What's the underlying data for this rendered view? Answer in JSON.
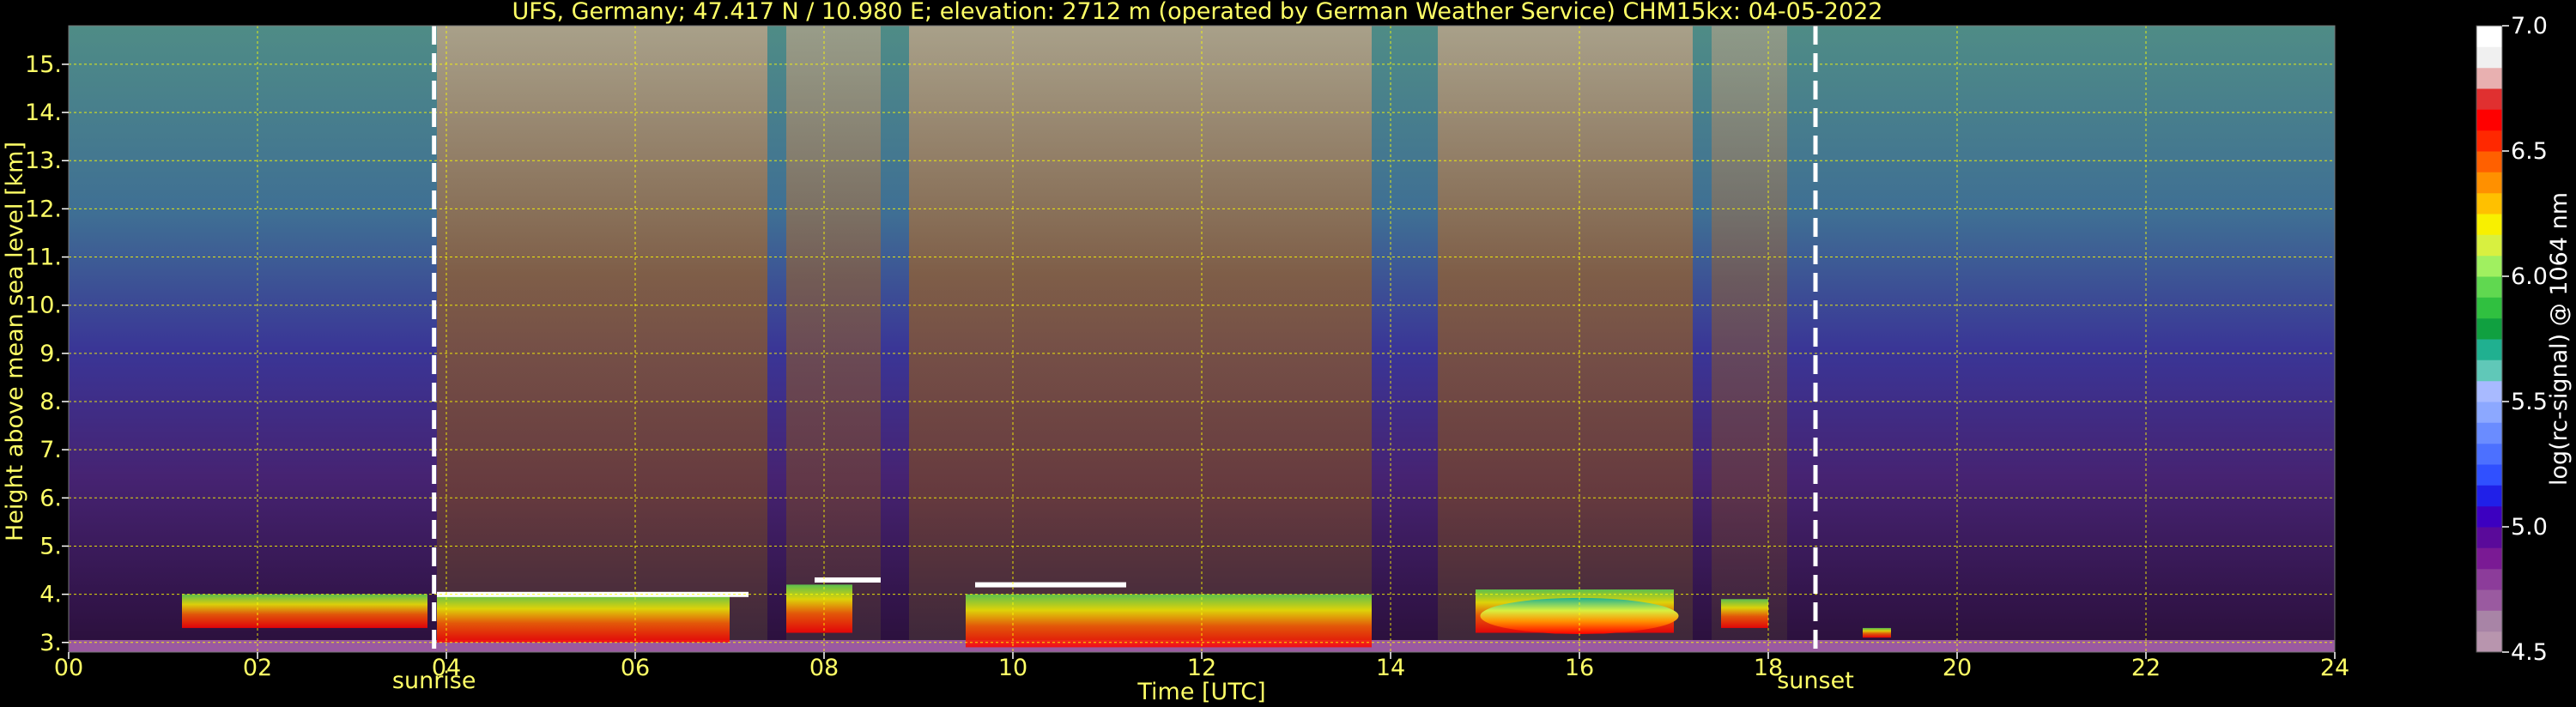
{
  "colors": {
    "background": "#000000",
    "annotation_text": "#ffff66",
    "grid": "#ffff00",
    "event_line": "#ffffff",
    "colorbar_text": "#ffffff"
  },
  "chart_data": {
    "type": "heatmap",
    "title": "UFS, Germany; 47.417 N / 10.980 E; elevation: 2712 m  (operated by German Weather Service)    CHM15kx: 04-05-2022",
    "xlabel": "Time [UTC]",
    "ylabel": "Height above mean sea level [km]",
    "xlim": [
      0,
      24
    ],
    "ylim": [
      2.8,
      15.8
    ],
    "x_ticks": [
      0,
      2,
      4,
      6,
      8,
      10,
      12,
      14,
      16,
      18,
      20,
      22,
      24
    ],
    "x_tick_labels": [
      "00",
      "02",
      "04",
      "06",
      "08",
      "10",
      "12",
      "14",
      "16",
      "18",
      "20",
      "22",
      "24"
    ],
    "y_ticks": [
      3,
      4,
      5,
      6,
      7,
      8,
      9,
      10,
      11,
      12,
      13,
      14,
      15
    ],
    "y_tick_labels": [
      "3.",
      "4.",
      "5.",
      "6.",
      "7.",
      "8.",
      "9.",
      "10.",
      "11.",
      "12.",
      "13.",
      "14.",
      "15."
    ],
    "grid": true,
    "events": [
      {
        "label": "sunrise",
        "time": 3.87
      },
      {
        "label": "sunset",
        "time": 18.5
      }
    ],
    "colorbar": {
      "label": "log(rc-signal) @ 1064 nm",
      "range": [
        4.5,
        7.0
      ],
      "tick_values": [
        4.5,
        5.0,
        5.5,
        6.0,
        6.5,
        7.0
      ],
      "tick_labels": [
        "4.5",
        "5.0",
        "5.5",
        "6.0",
        "6.5",
        "7.0"
      ],
      "colors": [
        "#b895ae",
        "#a884a6",
        "#9a5aa0",
        "#8c3c9a",
        "#7a1a94",
        "#5a0a9a",
        "#3c00c0",
        "#2020e8",
        "#3050ff",
        "#4c70ff",
        "#6a8cff",
        "#8ca8ff",
        "#a8baff",
        "#60c8b8",
        "#20b090",
        "#10a040",
        "#30c040",
        "#60d850",
        "#a0f060",
        "#d8f040",
        "#f8f000",
        "#ffc000",
        "#ff9000",
        "#ff6000",
        "#ff2800",
        "#ff0000",
        "#e03030",
        "#e8b0b0",
        "#f0f0f0",
        "#ffffff"
      ],
      "boundaries": [
        4.5,
        4.583,
        4.667,
        4.75,
        4.833,
        4.917,
        5.0,
        5.083,
        5.167,
        5.25,
        5.333,
        5.417,
        5.5,
        5.583,
        5.667,
        5.75,
        5.833,
        5.917,
        6.0,
        6.083,
        6.167,
        6.25,
        6.333,
        6.417,
        6.5,
        6.583,
        6.667,
        6.75,
        6.833,
        6.917,
        7.0
      ]
    }
  }
}
